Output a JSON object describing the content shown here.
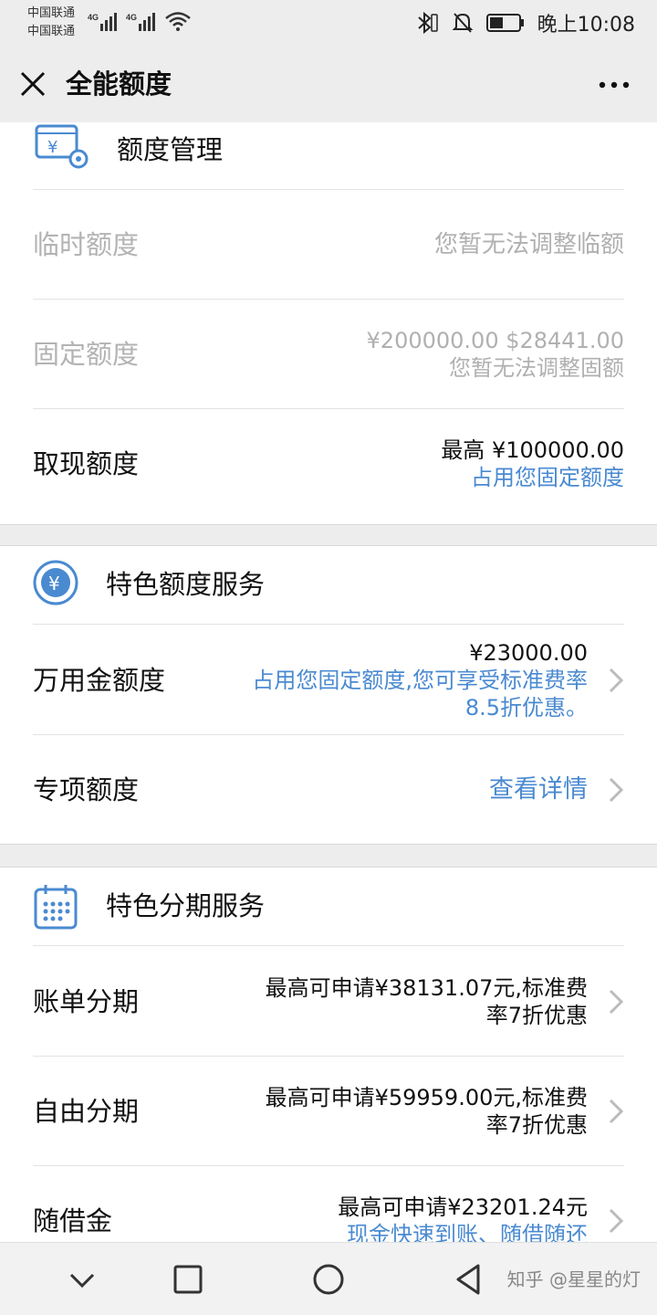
{
  "status_bar": {
    "carrier_1": "中国联通",
    "carrier_2": "中国联通",
    "net_1": "4G",
    "net_2": "4G",
    "time": "晚上10:08"
  },
  "nav": {
    "title": "全能额度"
  },
  "sections": {
    "quota_management": {
      "title": "额度管理",
      "rows": [
        {
          "label": "临时额度",
          "lines": [
            "您暂无法调整临额"
          ]
        },
        {
          "label": "固定额度",
          "lines": [
            "¥200000.00 $28441.00",
            "您暂无法调整固额"
          ]
        },
        {
          "label": "取现额度",
          "lines": [
            "最高 ¥100000.00",
            "占用您固定额度"
          ]
        }
      ]
    },
    "special_quota": {
      "title": "特色额度服务",
      "rows": [
        {
          "label": "万用金额度",
          "lines": [
            "¥23000.00",
            "占用您固定额度,您可享受标准费率",
            "8.5折优惠。"
          ]
        },
        {
          "label": "专项额度",
          "lines": [
            "查看详情"
          ]
        }
      ]
    },
    "installment": {
      "title": "特色分期服务",
      "rows": [
        {
          "label": "账单分期",
          "lines": [
            "最高可申请¥38131.07元,标准费",
            "率7折优惠"
          ]
        },
        {
          "label": "自由分期",
          "lines": [
            "最高可申请¥59959.00元,标准费",
            "率7折优惠"
          ]
        },
        {
          "label": "随借金",
          "lines": [
            "最高可申请¥23201.24元",
            "现金快速到账、随借随还"
          ]
        }
      ]
    }
  },
  "watermark": "知乎 @星星的灯",
  "colors": {
    "accent_blue": "#4a8ad1",
    "disabled_gray": "#b3b3b3",
    "page_bg": "#ededed"
  }
}
